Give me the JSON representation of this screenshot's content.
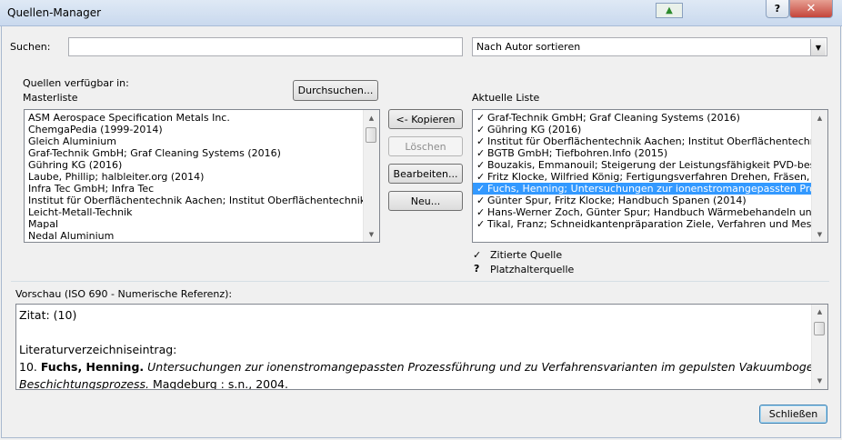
{
  "window": {
    "title": "Quellen-Manager",
    "help_label": "?",
    "close_label": "✕"
  },
  "search": {
    "label": "Suchen:",
    "value": "",
    "sort_value": "Nach Autor sortieren"
  },
  "sources_available_label": "Quellen verfügbar in:",
  "masterlist": {
    "label": "Masterliste",
    "browse_label": "Durchsuchen...",
    "items": [
      "ASM Aerospace Specification Metals Inc.",
      "ChemgaPedia (1999-2014)",
      "Gleich Aluminium",
      "Graf-Technik GmbH; Graf Cleaning Systems (2016)",
      "Gühring KG (2016)",
      "Laube, Phillip; halbleiter.org (2014)",
      "Infra Tec GmbH; Infra Tec",
      "Institut für Oberflächentechnik Aachen; Institut Oberflächentechnik (N...",
      "Leicht-Metall-Technik",
      "Mapal",
      "Nedal Aluminium"
    ]
  },
  "actions": {
    "copy_label": "<- Kopieren",
    "delete_label": "Löschen",
    "edit_label": "Bearbeiten...",
    "new_label": "Neu..."
  },
  "current_list": {
    "label": "Aktuelle Liste",
    "check_glyph": "✓",
    "selected_index": 7,
    "items": [
      "Graf-Technik GmbH; Graf Cleaning Systems (2016)",
      "Gühring KG (2016)",
      "Institut für Oberflächentechnik Aachen; Institut Oberflächentechnik (",
      "BGTB GmbH; Tiefbohren.Info  (2015)",
      "Bouzakis, Emmanouil; Steigerung der Leistungsfähigkeit PVD-beschic",
      "Fritz Klocke, Wilfried König; Fertigungsverfahren Drehen, Fräsen, Boh",
      "Fuchs, Henning; Untersuchungen zur ionenstromangepassten Prozes",
      "Günter Spur, Fritz Klocke; Handbuch Spanen (2014)",
      "Hans-Werner Zoch, Günter Spur; Handbuch Wärmebehandeln und Be",
      "Tikal, Franz; Schneidkantenpräparation Ziele, Verfahren und Messmet"
    ]
  },
  "legend": {
    "cited_glyph": "✓",
    "cited_label": "Zitierte Quelle",
    "placeholder_glyph": "?",
    "placeholder_label": "Platzhalterquelle"
  },
  "preview": {
    "label": "Vorschau (ISO 690 - Numerische Referenz):",
    "citation": "Zitat:  (10)",
    "bib_heading": "Literaturverzeichniseintrag:",
    "entry_number": "10.",
    "entry_author": "Fuchs, Henning.",
    "entry_title_line1": "Untersuchungen zur ionenstromangepassten Prozessführung und zu Verfahrensvarianten im gepulsten Vakuumbogen-",
    "entry_title_line2": "Beschichtungsprozess.",
    "entry_rest": " Magdeburg : s.n., 2004."
  },
  "close_button_label": "Schließen"
}
